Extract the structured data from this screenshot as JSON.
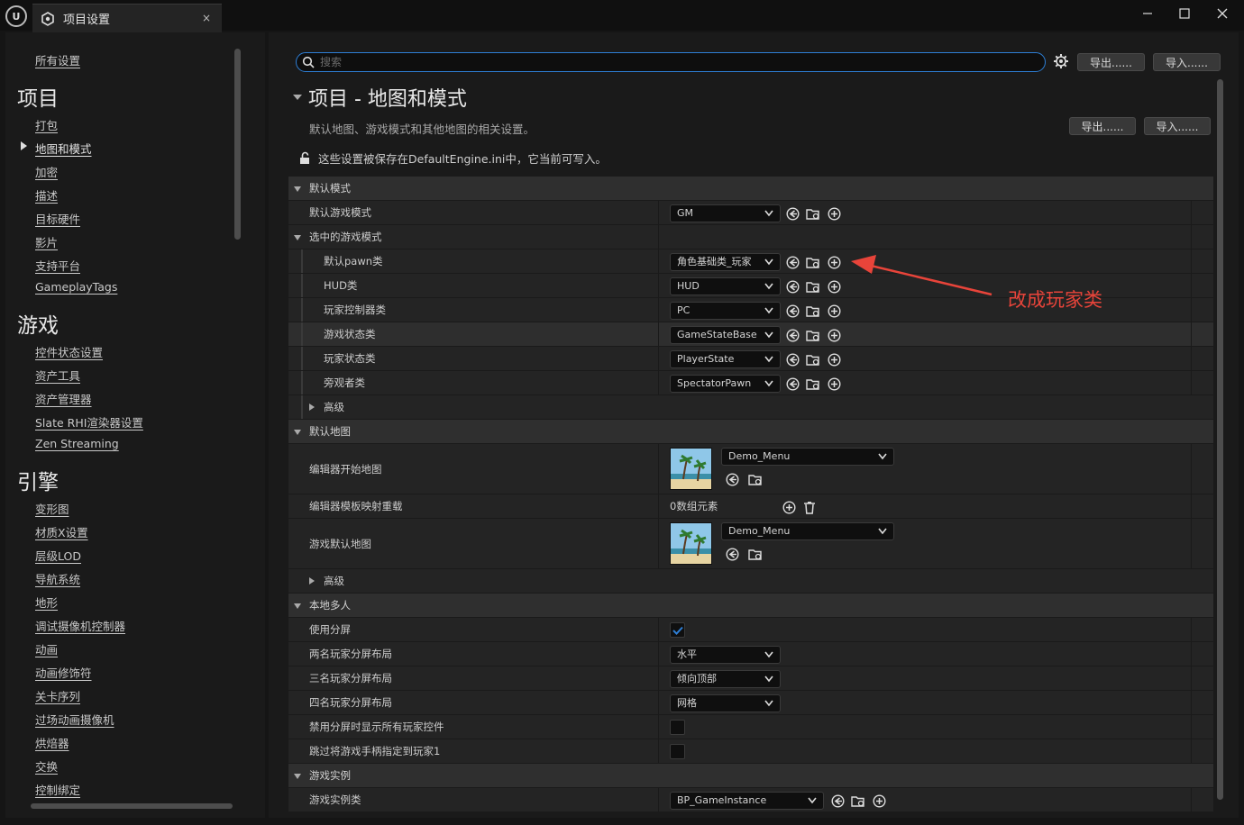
{
  "window": {
    "logo": "U",
    "tab_title": "项目设置",
    "close": "×",
    "min": "—",
    "max": "□",
    "x": "✕"
  },
  "sidebar": {
    "all_settings": "所有设置",
    "sections": [
      {
        "title": "项目",
        "items": [
          "打包",
          "地图和模式",
          "加密",
          "描述",
          "目标硬件",
          "影片",
          "支持平台",
          "GameplayTags"
        ]
      },
      {
        "title": "游戏",
        "items": [
          "控件状态设置",
          "资产工具",
          "资产管理器",
          "Slate RHI渲染器设置",
          "Zen Streaming"
        ]
      },
      {
        "title": "引擎",
        "items": [
          "变形图",
          "材质X设置",
          "层级LOD",
          "导航系统",
          "地形",
          "调试摄像机控制器",
          "动画",
          "动画修饰符",
          "关卡序列",
          "过场动画摄像机",
          "烘焙器",
          "交换",
          "控制绑定"
        ]
      }
    ],
    "active_item": "地图和模式"
  },
  "toolbar": {
    "search_placeholder": "搜索",
    "export_label": "导出......",
    "import_label": "导入......"
  },
  "page": {
    "title": "项目 - 地图和模式",
    "description": "默认地图、游戏模式和其他地图的相关设置。",
    "export_label": "导出......",
    "import_label": "导入......",
    "ini_notice": "这些设置被保存在DefaultEngine.ini中，它当前可写入。"
  },
  "grid": {
    "cat_default_modes": "默认模式",
    "default_game_mode": {
      "label": "默认游戏模式",
      "value": "GM"
    },
    "cat_selected_mode": "选中的游戏模式",
    "pawn": {
      "label": "默认pawn类",
      "value": "角色基础类_玩家"
    },
    "hud": {
      "label": "HUD类",
      "value": "HUD"
    },
    "pc": {
      "label": "玩家控制器类",
      "value": "PC"
    },
    "gamestate": {
      "label": "游戏状态类",
      "value": "GameStateBase"
    },
    "playerstate": {
      "label": "玩家状态类",
      "value": "PlayerState"
    },
    "spectator": {
      "label": "旁观者类",
      "value": "SpectatorPawn"
    },
    "advanced_1": "高级",
    "cat_default_maps": "默认地图",
    "editor_startup_map": {
      "label": "编辑器开始地图",
      "value": "Demo_Menu"
    },
    "editor_template_override": {
      "label": "编辑器模板映射重载",
      "value": "0数组元素"
    },
    "game_default_map": {
      "label": "游戏默认地图",
      "value": "Demo_Menu"
    },
    "advanced_2": "高级",
    "cat_local_multiplayer": "本地多人",
    "use_splitscreen": {
      "label": "使用分屏",
      "checked": true
    },
    "two_player_layout": {
      "label": "两名玩家分屏布局",
      "value": "水平"
    },
    "three_player_layout": {
      "label": "三名玩家分屏布局",
      "value": "倾向顶部"
    },
    "four_player_layout": {
      "label": "四名玩家分屏布局",
      "value": "网格"
    },
    "disable_splitscreen_widgets": {
      "label": "禁用分屏时显示所有玩家控件",
      "checked": false
    },
    "skip_gamepad": {
      "label": "跳过将游戏手柄指定到玩家1",
      "checked": false
    },
    "cat_game_instance": "游戏实例",
    "game_instance_class": {
      "label": "游戏实例类",
      "value": "BP_GameInstance"
    }
  },
  "annotation": {
    "text": "改成玩家类",
    "color": "#e8443a"
  },
  "colors": {
    "accent": "#2e7fd6",
    "background": "#1a1a1a"
  }
}
